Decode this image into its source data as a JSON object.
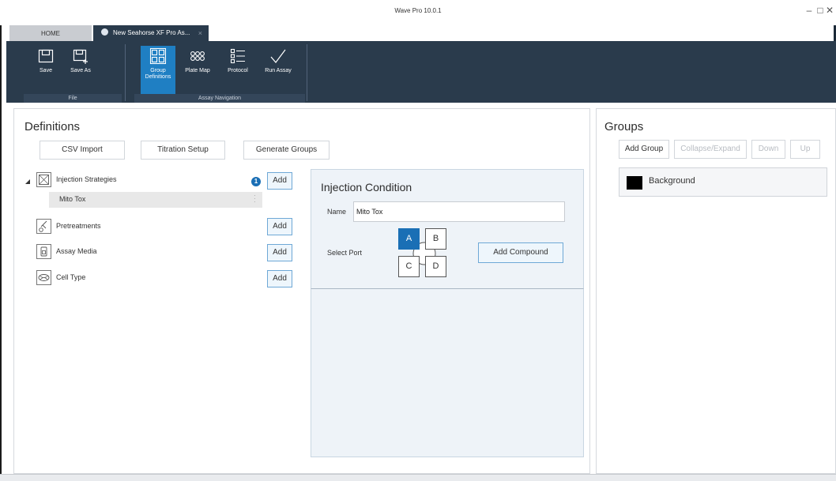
{
  "window": {
    "title": "Wave Pro 10.0.1",
    "controls": [
      "–",
      "□",
      "✕"
    ]
  },
  "tabs": [
    {
      "label": "HOME"
    },
    {
      "label": "New Seahorse XF Pro As...",
      "close": "×"
    }
  ],
  "ribbon": {
    "file_group_label": "File",
    "nav_group_label": "Assay Navigation",
    "buttons": [
      {
        "label": "Save",
        "icon": "save-icon"
      },
      {
        "label": "Save As",
        "icon": "save-as-icon"
      },
      {
        "label": "Group Definitions",
        "icon": "group-definitions-icon"
      },
      {
        "label": "Plate Map",
        "icon": "plate-map-icon"
      },
      {
        "label": "Protocol",
        "icon": "protocol-icon"
      },
      {
        "label": "Run Assay",
        "icon": "run-assay-icon"
      }
    ]
  },
  "definitions": {
    "title": "Definitions",
    "toolbar": [
      "CSV Import",
      "Titration Setup",
      "Generate Groups"
    ],
    "tree": [
      {
        "label": "Injection Strategies",
        "add": "Add",
        "badge": "1",
        "icon": "injection-strategies-icon"
      },
      {
        "label": "Pretreatments",
        "add": "Add",
        "icon": "pretreatments-icon"
      },
      {
        "label": "Assay Media",
        "add": "Add",
        "icon": "assay-media-icon"
      },
      {
        "label": "Cell Type",
        "add": "Add",
        "icon": "cell-type-icon"
      }
    ],
    "selected_child": "Mito Tox"
  },
  "injection": {
    "title": "Injection Condition",
    "name_label": "Name",
    "name_value": "Mito Tox",
    "port_label": "Select Port",
    "ports": [
      "A",
      "B",
      "C",
      "D"
    ],
    "active_port": "A",
    "add_compound": "Add Compound"
  },
  "groups": {
    "title": "Groups",
    "toolbar": [
      {
        "label": "Add Group",
        "enabled": true
      },
      {
        "label": "Collapse/Expand",
        "enabled": false
      },
      {
        "label": "Down",
        "enabled": false
      },
      {
        "label": "Up",
        "enabled": false
      }
    ],
    "items": [
      {
        "label": "Background",
        "color": "#000000"
      }
    ]
  },
  "colors": {
    "ribbon": "#2a3b4c",
    "accent": "#1a6fb5"
  }
}
